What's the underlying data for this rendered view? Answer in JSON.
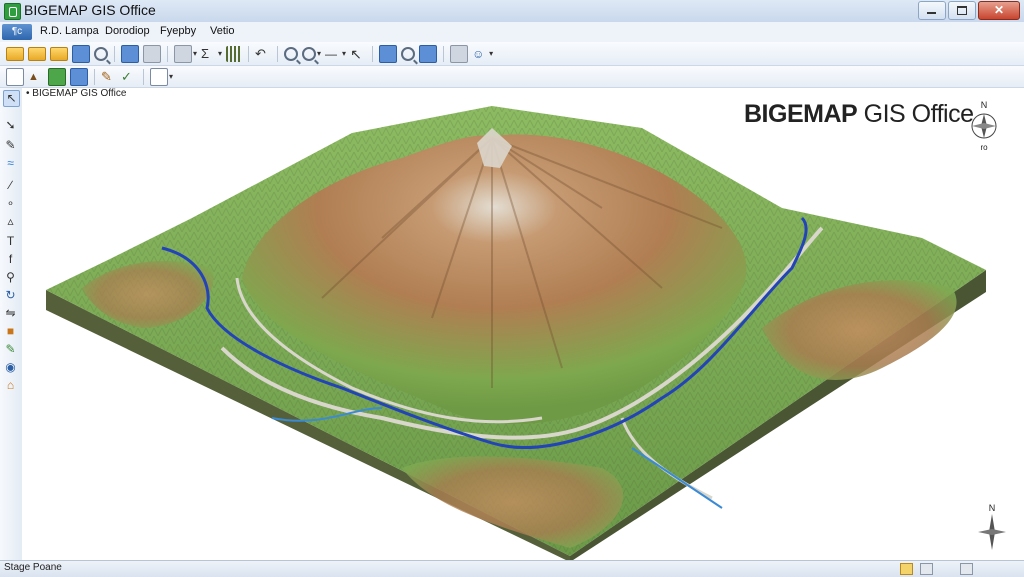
{
  "window": {
    "title": "BIGEMAP GIS Office",
    "close_label": "✕"
  },
  "menubar": {
    "app_button_label": "¶c",
    "items": [
      {
        "label": "R.D. Lampa"
      },
      {
        "label": "Dorodiop"
      },
      {
        "label": "Fyepby"
      },
      {
        "label": "Vetio"
      }
    ]
  },
  "map": {
    "document_tab_label": "• BIGEMAP GIS Office",
    "watermark_brand": "BIGEMAP",
    "watermark_product": "GIS Office",
    "compass_top_north_label": "N",
    "compass_top_bottom_label": "ro",
    "compass_bottom_north_label": "N",
    "colors": {
      "lowland": "#7fae5a",
      "highland": "#bf8a5e",
      "peak": "#d8d2c6",
      "river": "#2343b8",
      "road": "#d9d6cc",
      "base": "#55603a"
    }
  },
  "statusbar": {
    "text": "Stage Poane"
  },
  "icons": {
    "toolbar1": [
      "new-folder-icon",
      "open-folder-icon",
      "save-icon",
      "layers-icon",
      "search-icon",
      "import-icon",
      "export-icon",
      "settings-icon",
      "sigma-icon",
      "chart-icon",
      "undo-icon",
      "zoom-in-icon",
      "zoom-out-icon",
      "line-icon",
      "measure-icon",
      "gradient-icon",
      "globe-icon",
      "print-icon",
      "person-icon"
    ],
    "toolbar2": [
      "select-icon",
      "triangle-icon",
      "layer-icon",
      "table-icon",
      "pencil-icon",
      "check-icon",
      "document-icon"
    ],
    "left": [
      "pointer-icon",
      "pan-icon",
      "draw-icon",
      "river-icon",
      "line-tool-icon",
      "point-tool-icon",
      "polygon-tool-icon",
      "text-tool-icon",
      "measure-tool-icon",
      "edit-tool-icon",
      "rotate-icon",
      "ruler-icon",
      "color-icon",
      "globe-tool-icon",
      "house-icon"
    ]
  }
}
